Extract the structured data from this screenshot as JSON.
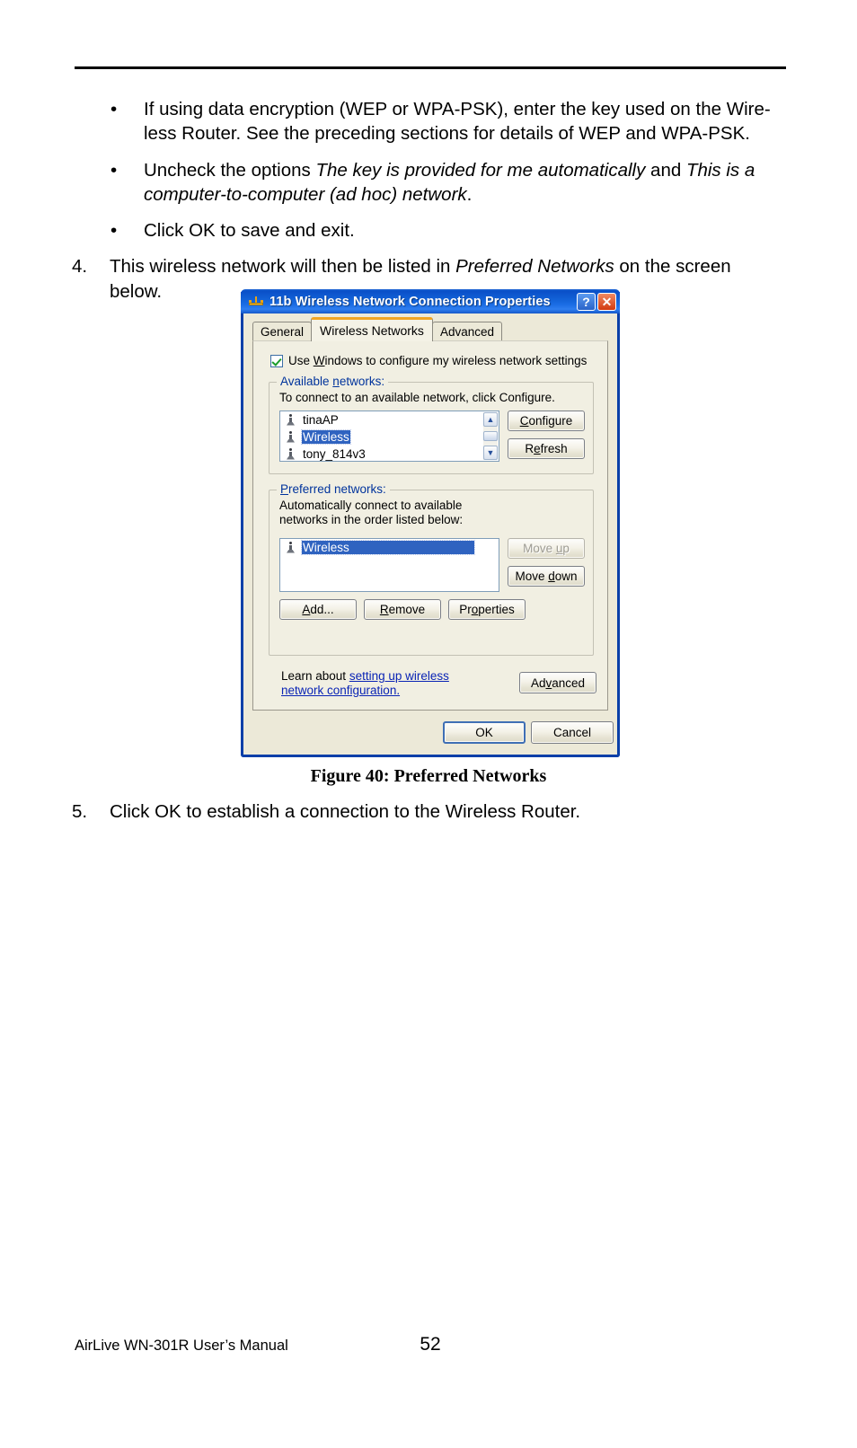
{
  "document": {
    "bullets": [
      {
        "marker": "•",
        "html": "If using data encryption (WEP or WPA-PSK), enter the key used on the Wire-less Router. See the preceding sections for details of WEP and WPA-PSK."
      },
      {
        "marker": "•",
        "html": "Uncheck the options <em>The key is provided for me automatically</em> and <em>This is a computer-to-computer (ad hoc) network</em>."
      },
      {
        "marker": "•",
        "html": "Click OK to save and exit."
      }
    ],
    "step4": {
      "number": "4.",
      "html": "This wireless network will then be listed in <em>Preferred Networks</em> on the screen below."
    },
    "step5": {
      "number": "5.",
      "html": "Click OK to establish a connection to the Wireless Router."
    },
    "figure_caption": "Figure 40: Preferred Networks",
    "footer": {
      "left": "AirLive WN-301R User’s Manual",
      "page_number": "52"
    }
  },
  "dialog": {
    "title": "11b Wireless Network Connection Properties",
    "title_icon": "network-connection-icon",
    "caption_buttons": {
      "help": "?",
      "close": "✕"
    },
    "tabs": [
      {
        "label": "General",
        "active": false
      },
      {
        "label": "Wireless Networks",
        "active": true
      },
      {
        "label": "Advanced",
        "active": false
      }
    ],
    "use_windows_checkbox": {
      "checked": true,
      "label_pre": "Use ",
      "label_accel": "W",
      "label_post": "indows to configure my wireless network settings"
    },
    "available": {
      "group_title_pre": "Available ",
      "group_title_accel": "n",
      "group_title_post": "etworks:",
      "hint": "To connect to an available network, click Configure.",
      "items": [
        {
          "name": "tinaAP",
          "selected": false
        },
        {
          "name": "Wireless",
          "selected": true
        },
        {
          "name": "tony_814v3",
          "selected": false
        }
      ],
      "scrollbar": {
        "up": "▲",
        "down": "▼"
      },
      "configure_button": "Configure",
      "refresh_button": "Refresh"
    },
    "preferred": {
      "group_title_pre": "P",
      "group_title_post": "referred networks:",
      "hint": "Automatically connect to available networks in the order listed below:",
      "items": [
        {
          "name": "Wireless",
          "selected": true
        }
      ],
      "move_up_button": "Move up",
      "move_up_disabled": true,
      "move_down_button": "Move down",
      "add_button": "Add...",
      "remove_button": "Remove",
      "properties_button": "Properties"
    },
    "learn": {
      "prefix": "Learn about ",
      "link": "setting up wireless network configuration."
    },
    "advanced_button": "Advanced",
    "ok_button": "OK",
    "cancel_button": "Cancel"
  },
  "colors": {
    "title_bar_blue": "#0a50c8",
    "dialog_face": "#ece9d8",
    "tab_page": "#f1efe2",
    "selection_blue": "#2f63c0",
    "group_title": "#00339c",
    "link_blue": "#0a24b5",
    "active_tab_accent": "#f0a523",
    "close_button_red": "#d23a10"
  }
}
